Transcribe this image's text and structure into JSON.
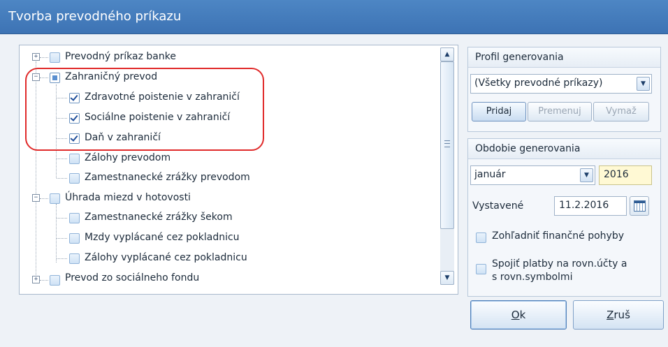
{
  "window": {
    "title": "Tvorba prevodného príkazu"
  },
  "tree": {
    "items": [
      {
        "label": "Prevodný príkaz banke"
      },
      {
        "label": "Zahraničný prevod"
      },
      {
        "label": "Zdravotné poistenie v zahraničí"
      },
      {
        "label": "Sociálne poistenie v zahraničí"
      },
      {
        "label": "Daň v zahraničí"
      },
      {
        "label": "Zálohy prevodom"
      },
      {
        "label": "Zamestnanecké zrážky prevodom"
      },
      {
        "label": "Úhrada miezd v hotovosti"
      },
      {
        "label": "Zamestnanecké zrážky šekom"
      },
      {
        "label": "Mzdy vyplácané cez pokladnicu"
      },
      {
        "label": "Zálohy vyplácané cez pokladnicu"
      },
      {
        "label": "Prevod zo sociálneho fondu"
      }
    ]
  },
  "profile": {
    "title": "Profil generovania",
    "selected": "(Všetky prevodné príkazy)",
    "add": "Pridaj",
    "rename": "Premenuj",
    "delete": "Vymaž"
  },
  "period": {
    "title": "Obdobie generovania",
    "month": "január",
    "year": "2016",
    "issued_label": "Vystavené",
    "issued_date": "11.2.2016",
    "opt1": "Zohľadniť finančné pohyby",
    "opt2_line1": "Spojiť platby na rovn.účty a",
    "opt2_line2": "s rovn.symbolmi"
  },
  "buttons": {
    "ok_key": "O",
    "ok_rest": "k",
    "cancel_key": "Z",
    "cancel_rest": "ruš"
  },
  "colors": {
    "titlebar": "#4a84c3",
    "highlight": "#e02a2a",
    "year_bg": "#fff9d4"
  }
}
